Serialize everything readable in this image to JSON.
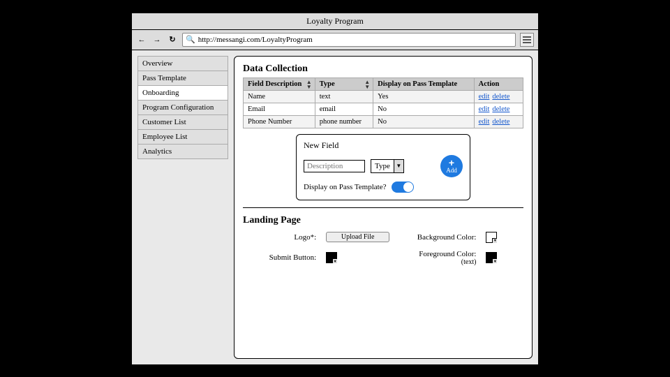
{
  "window": {
    "title": "Loyalty Program"
  },
  "url": "http://messangi.com/LoyaltyProgram",
  "sidebar": {
    "items": [
      {
        "label": "Overview"
      },
      {
        "label": "Pass Template"
      },
      {
        "label": "Onboarding"
      },
      {
        "label": "Program Configuration"
      },
      {
        "label": "Customer List"
      },
      {
        "label": "Employee List"
      },
      {
        "label": "Analytics"
      }
    ],
    "active_index": 2
  },
  "data_collection": {
    "title": "Data Collection",
    "headers": {
      "desc": "Field Description",
      "type": "Type",
      "display": "Display on Pass Template",
      "action": "Action"
    },
    "rows": [
      {
        "desc": "Name",
        "type": "text",
        "display": "Yes"
      },
      {
        "desc": "Email",
        "type": "email",
        "display": "No"
      },
      {
        "desc": "Phone Number",
        "type": "phone number",
        "display": "No"
      }
    ],
    "actions": {
      "edit": "edit",
      "delete": "delete"
    }
  },
  "new_field": {
    "title": "New Field",
    "desc_placeholder": "Description",
    "type_placeholder": "Type",
    "display_question": "Display on Pass Template?",
    "add_label": "Add"
  },
  "landing_page": {
    "title": "Landing Page",
    "logo_label": "Logo*:",
    "upload_label": "Upload File",
    "background_label": "Background Color:",
    "submit_label": "Submit Button:",
    "foreground_label": "Foreground Color:",
    "foreground_sub": "(text)"
  }
}
